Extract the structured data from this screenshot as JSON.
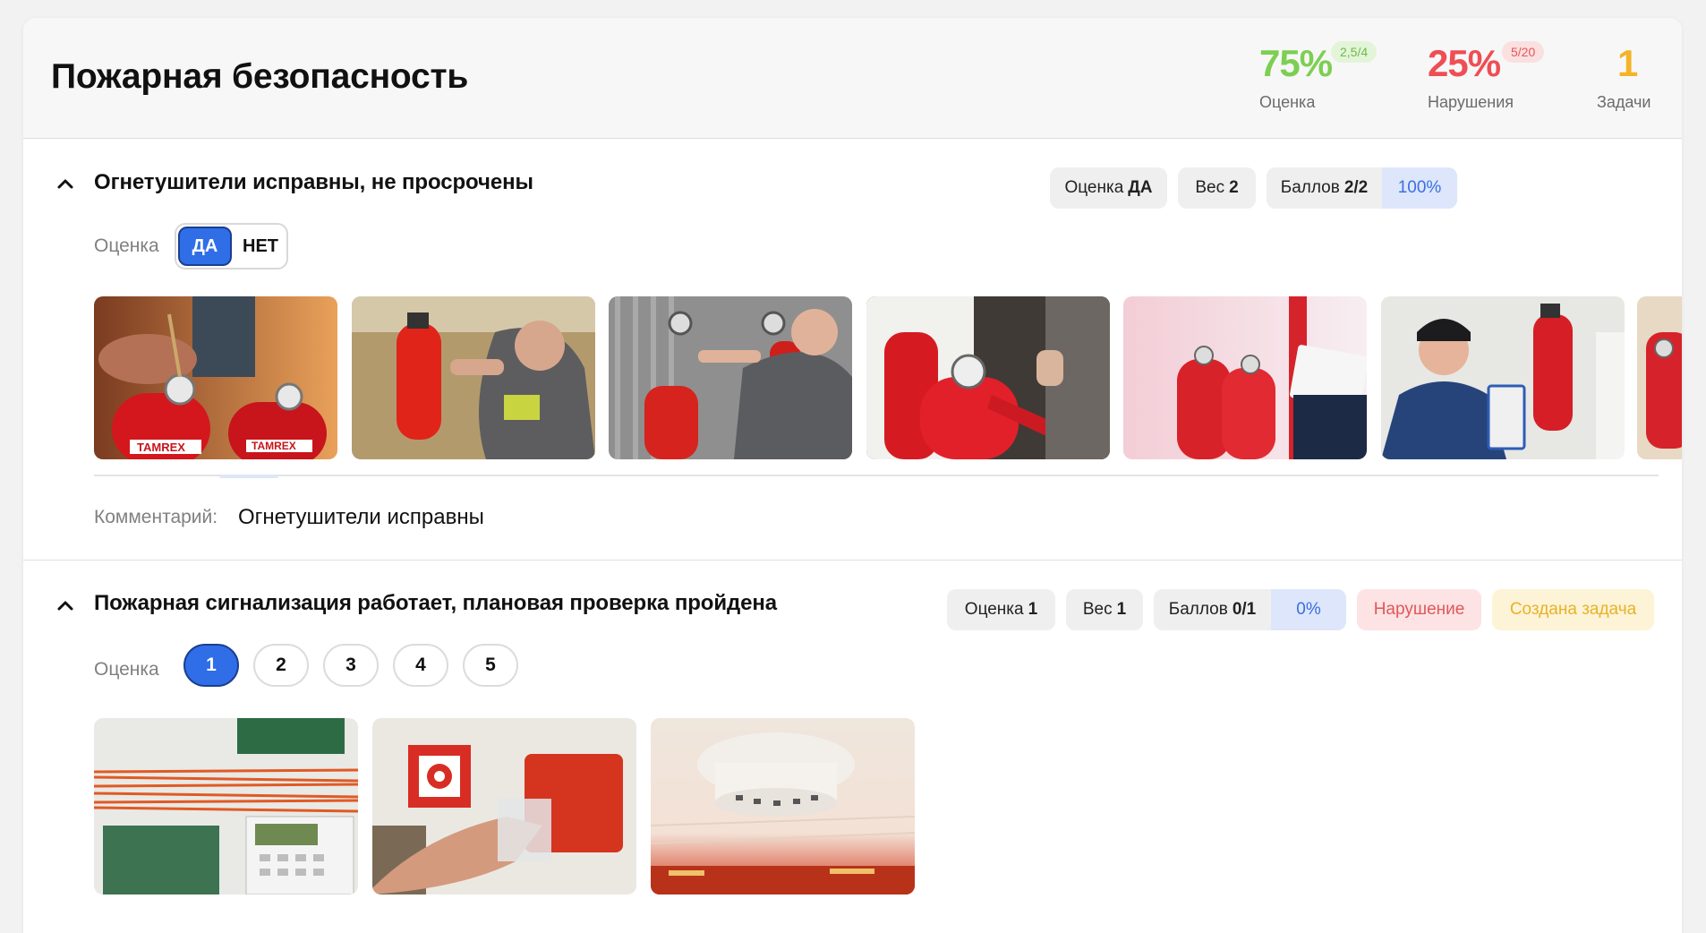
{
  "header": {
    "title": "Пожарная безопасность",
    "score": {
      "value": "75%",
      "tag": "2,5/4",
      "label": "Оценка",
      "color": "#7ccf52"
    },
    "violations": {
      "value": "25%",
      "tag": "5/20",
      "label": "Нарушения",
      "color": "#ee4e54"
    },
    "tasks": {
      "value": "1",
      "label": "Задачи",
      "color": "#f5b327"
    }
  },
  "sections": [
    {
      "title": "Огнетушители исправны, не просрочены",
      "rating_label": "Оценка",
      "pills": {
        "score_label": "Оценка",
        "score_value": "ДА",
        "weight_label": "Вес",
        "weight_value": "2",
        "points_label": "Баллов",
        "points_value": "2/2",
        "percent": "100%"
      },
      "toggle": {
        "yes": "ДА",
        "no": "НЕТ",
        "selected": "ДА"
      },
      "photos": [
        {
          "icon": "fire-extinguisher-inspection-photo",
          "brand_text": "TAMREX",
          "brand_text_2": "TAMREX"
        },
        {
          "icon": "fire-extinguisher-service-photo"
        },
        {
          "icon": "fire-extinguisher-gauge-photo"
        },
        {
          "icon": "fire-extinguisher-closeup-photo"
        },
        {
          "icon": "fire-extinguisher-checklist-photo"
        },
        {
          "icon": "fire-extinguisher-wall-inspection-photo"
        },
        {
          "icon": "fire-extinguisher-partial-photo"
        }
      ],
      "comment_label": "Комментарий:",
      "comment": "Огнетушители исправны"
    },
    {
      "title": "Пожарная сигнализация работает, плановая проверка пройдена",
      "rating_label": "Оценка",
      "pills": {
        "score_label": "Оценка",
        "score_value": "1",
        "weight_label": "Вес",
        "weight_value": "1",
        "points_label": "Баллов",
        "points_value": "0/1",
        "percent": "0%",
        "violation": "Нарушение",
        "task": "Создана задача"
      },
      "rating_options": [
        "1",
        "2",
        "3",
        "4",
        "5"
      ],
      "rating_selected": "1",
      "photos": [
        {
          "icon": "alarm-control-panel-photo"
        },
        {
          "icon": "manual-call-point-photo"
        },
        {
          "icon": "smoke-detector-photo"
        }
      ]
    }
  ]
}
